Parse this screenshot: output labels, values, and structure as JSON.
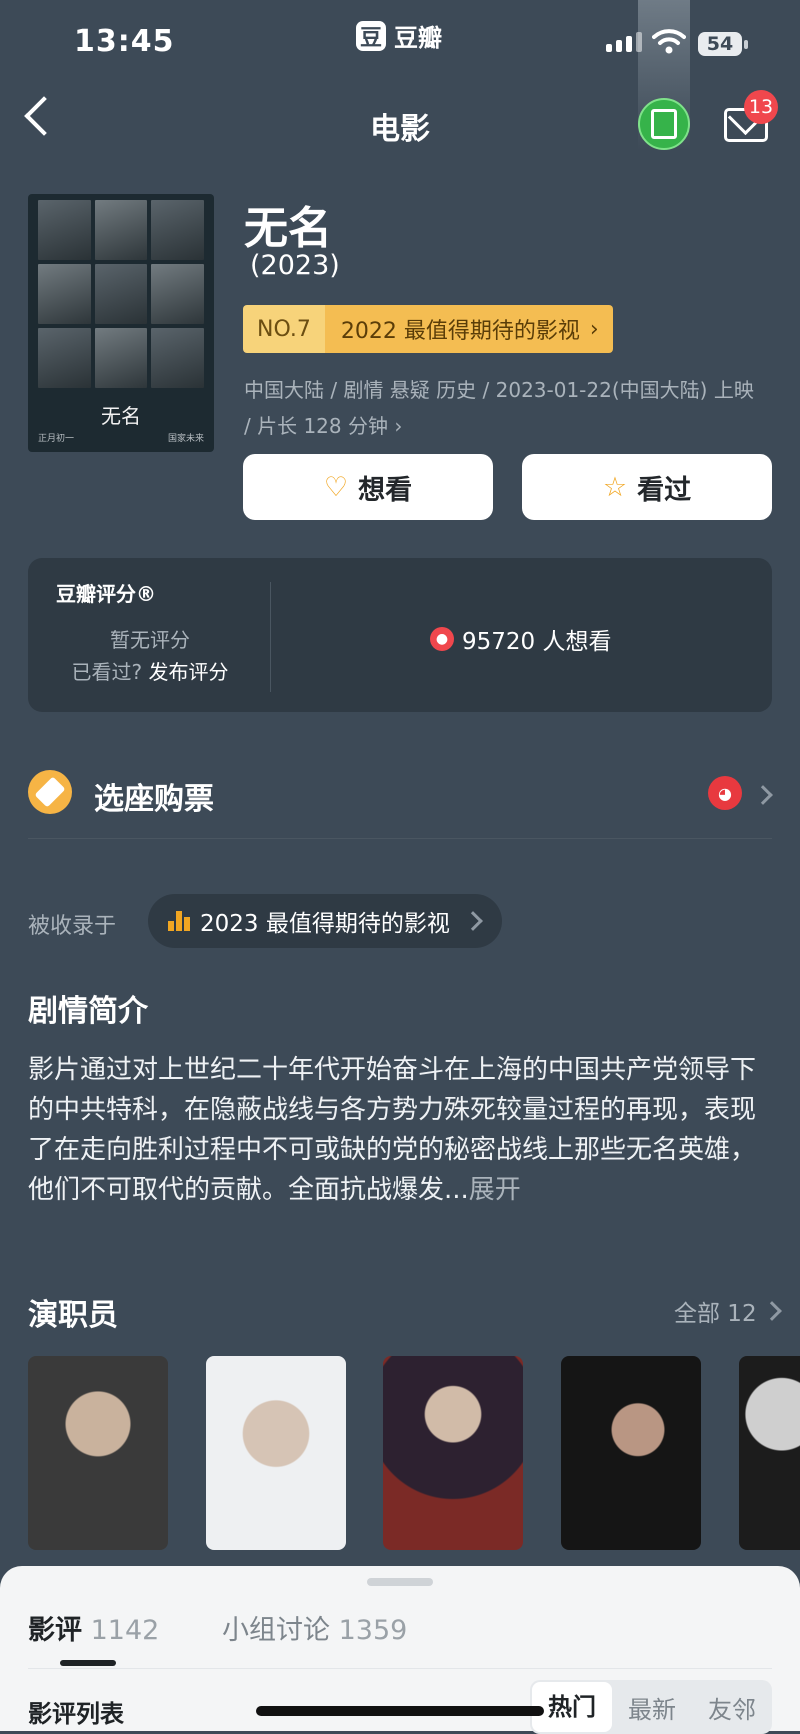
{
  "status_bar": {
    "time": "13:45",
    "app_label": "豆瓣",
    "app_icon": "豆",
    "battery": "54"
  },
  "nav": {
    "title": "电影",
    "mail_count": "13"
  },
  "poster": {
    "title": "无名",
    "tagline_left": "正月初一",
    "tagline_right": "国家未来"
  },
  "movie": {
    "title": "无名",
    "year": "(2023)",
    "rank_no": "NO.7",
    "rank_list": "2022 最值得期待的影视",
    "meta": "中国大陆 / 剧情 悬疑 历史 / 2023-01-22(中国大陆) 上映 / 片长 128 分钟 ›"
  },
  "actions": {
    "want": "想看",
    "seen": "看过"
  },
  "rating": {
    "title": "豆瓣评分®",
    "none": "暂无评分",
    "seen_q": "已看过?",
    "publish": "发布评分",
    "want_count": "95720 人想看"
  },
  "ticket": {
    "label": "选座购票"
  },
  "collected": {
    "label": "被收录于",
    "list": "2023 最值得期待的影视"
  },
  "synopsis": {
    "title": "剧情简介",
    "text": "影片通过对上世纪二十年代开始奋斗在上海的中国共产党领导下的中共特科，在隐蔽战线与各方势力殊死较量过程的再现，表现了在走向胜利过程中不可或缺的党的秘密战线上那些无名英雄，他们不可取代的贡献。全面抗战爆发...",
    "more": "展开"
  },
  "cast": {
    "title": "演职员",
    "all": "全部 12"
  },
  "sheet": {
    "tab1_label": "影评",
    "tab1_count": "1142",
    "tab2_label": "小组讨论",
    "tab2_count": "1359",
    "list_label": "影评列表",
    "seg": [
      "热门",
      "最新",
      "友邻"
    ]
  },
  "colors": {
    "background": "#3d4a57",
    "accent": "#f1a622",
    "badge_red": "#f0474d"
  }
}
